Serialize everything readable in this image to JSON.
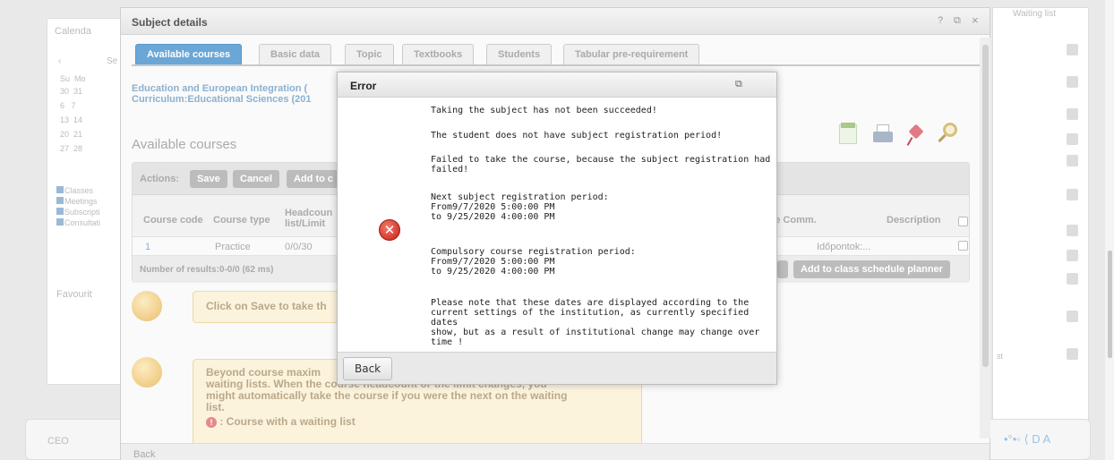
{
  "background": {
    "calendar_title": "Calenda",
    "calendar_month_initial": "Se",
    "weekday_row": "Su  Mo",
    "date_rows": [
      "30  31",
      "6   7",
      "13  14",
      "20  21",
      "27  28"
    ],
    "filters": [
      "Classes",
      "Meetings",
      "Subscripti",
      "Consultati"
    ],
    "favourites_label": "Favourit",
    "waiting_list_header": "Waiting list",
    "bottom_left_label": "CEO",
    "right_side_letter": "st"
  },
  "dialog": {
    "title": "Subject details",
    "help_glyph": "?",
    "tabs": [
      "Available courses",
      "Basic data",
      "Topic",
      "Textbooks",
      "Students",
      "Tabular pre-requirement"
    ],
    "info_line1": "Education and European Integration (",
    "info_line2": "Curriculum:Educational Sciences (201",
    "section_title": "Available courses",
    "actions_label": "Actions:",
    "save_label": "Save",
    "cancel_label": "Cancel",
    "add_to_label": "Add to c",
    "col_course_code": "Course code",
    "col_course_type": "Course type",
    "col_headcount": "Headcoun list/Limit",
    "col_site_comm": "e Site Comm.",
    "col_description": "Description",
    "row_code": "1",
    "row_type": "Practice",
    "row_headcount": "0/0/30",
    "row_site_comm": "Időpontok:...",
    "result_count": "Number of results:0-0/0 (62 ms)",
    "add_to_planner": "Add to class schedule planner",
    "hint1": "Click on Save to take th",
    "hint2_line1": "Beyond course maxim",
    "hint2_line2": "waiting lists. When the course headcount or the limit changes, you",
    "hint2_line3": "might automatically take the course if you were the next on the waiting",
    "hint2_line4": "list.",
    "hint2_line5": ": Course with a waiting list",
    "bottom_back": "Back"
  },
  "modal": {
    "title": "Error",
    "messages": [
      "Taking the subject has not been succeeded!",
      "The student does not have subject registration period!",
      "Failed to take the course, because the subject registration had\nfailed!",
      "Next subject registration period:\nFrom9/7/2020 5:00:00 PM\nto 9/25/2020 4:00:00 PM",
      "Compulsory course registration period:\nFrom9/7/2020 5:00:00 PM\nto 9/25/2020 4:00:00 PM",
      "Please note that these dates are displayed according to the\ncurrent settings of the institution, as currently specified dates\nshow, but as a result of institutional change may change over\ntime !"
    ],
    "back_label": "Back"
  },
  "colors": {
    "active_tab": "#6aa7d7",
    "error_red": "#d43a2b",
    "hint_bg": "#fcf3dd"
  }
}
